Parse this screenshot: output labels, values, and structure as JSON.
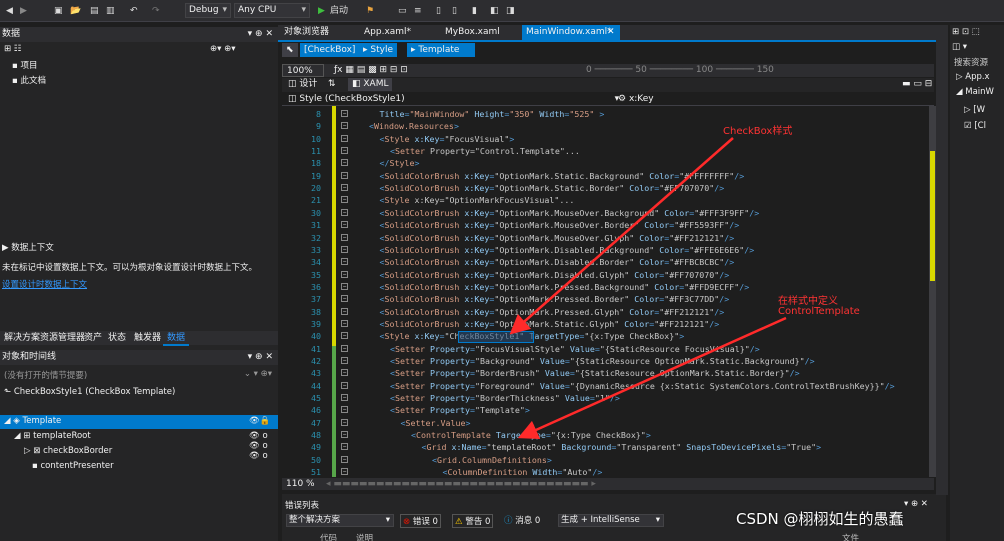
{
  "toolbar": {
    "config": "Debug",
    "platform": "Any CPU",
    "start": "启动"
  },
  "left": {
    "data_panel_title": "数据",
    "tree_items": [
      "项目",
      "此文档"
    ],
    "context_title": "数据上下文",
    "context_text": "未在标记中设置数据上下文。可以为根对象设置设计时数据上下文。",
    "context_link": "设置设计时数据上下文",
    "tabs": [
      "解决方案资源管理器",
      "资产",
      "状态",
      "触发器",
      "数据"
    ],
    "objects_title": "对象和时间线",
    "no_storyboard": "(没有打开的情节提要)",
    "style_title": "CheckBoxStyle1 (CheckBox Template)",
    "obj_tree": [
      "Template",
      "templateRoot",
      "checkBoxBorder",
      "contentPresenter"
    ]
  },
  "doc_tabs": [
    "对象浏览器",
    "App.xaml*",
    "MyBox.xaml",
    "MainWindow.xaml*"
  ],
  "breadcrumb": [
    "[CheckBox]",
    "Style",
    "Template"
  ],
  "design": {
    "zoom": "100%",
    "design_tab": "设计",
    "xaml_tab": "XAML"
  },
  "nav_left": "Style (CheckBoxStyle1)",
  "nav_right": "x:Key",
  "code_lines": [
    {
      "n": "8",
      "c": [
        [
          "t-att",
          "Title"
        ],
        [
          "t-tag",
          "="
        ],
        [
          "t-str",
          "\"MainWindow\""
        ],
        [
          "t-att",
          " Height"
        ],
        [
          "t-tag",
          "="
        ],
        [
          "t-str",
          "\"350\""
        ],
        [
          "t-att",
          " Width"
        ],
        [
          "t-tag",
          "="
        ],
        [
          "t-str",
          "\"525\""
        ],
        [
          "t-tag",
          " >"
        ]
      ],
      "i": 1
    },
    {
      "n": "9",
      "c": [
        [
          "t-tag",
          "<"
        ],
        [
          "t-str",
          "Window.Resources"
        ],
        [
          "t-tag",
          ">"
        ]
      ],
      "i": 0
    },
    {
      "n": "10",
      "c": [
        [
          "t-tag",
          "<"
        ],
        [
          "t-str",
          "Style"
        ],
        [
          "t-att",
          " x:Key"
        ],
        [
          "t-tag",
          "="
        ],
        [
          "t-val",
          "\"FocusVisual\""
        ],
        [
          "t-tag",
          ">"
        ]
      ],
      "i": 1
    },
    {
      "n": "11",
      "c": [
        [
          "t-tag",
          "<"
        ],
        [
          "t-str",
          "Setter"
        ],
        [
          "t-val",
          " Property=\"Control.Template\"..."
        ]
      ],
      "i": 2
    },
    {
      "n": "18",
      "c": [
        [
          "t-tag",
          "</"
        ],
        [
          "t-str",
          "Style"
        ],
        [
          "t-tag",
          ">"
        ]
      ],
      "i": 1
    },
    {
      "n": "19",
      "c": [
        [
          "t-tag",
          "<"
        ],
        [
          "t-str",
          "SolidColorBrush"
        ],
        [
          "t-att",
          " x:Key"
        ],
        [
          "t-tag",
          "="
        ],
        [
          "t-val",
          "\"OptionMark.Static.Background\""
        ],
        [
          "t-att",
          " Color"
        ],
        [
          "t-tag",
          "="
        ],
        [
          "t-val",
          "\"#FFFFFFFF\""
        ],
        [
          "t-tag",
          "/>"
        ]
      ],
      "i": 1
    },
    {
      "n": "20",
      "c": [
        [
          "t-tag",
          "<"
        ],
        [
          "t-str",
          "SolidColorBrush"
        ],
        [
          "t-att",
          " x:Key"
        ],
        [
          "t-tag",
          "="
        ],
        [
          "t-val",
          "\"OptionMark.Static.Border\""
        ],
        [
          "t-att",
          " Color"
        ],
        [
          "t-tag",
          "="
        ],
        [
          "t-val",
          "\"#FF707070\""
        ],
        [
          "t-tag",
          "/>"
        ]
      ],
      "i": 1
    },
    {
      "n": "21",
      "c": [
        [
          "t-tag",
          "<"
        ],
        [
          "t-str",
          "Style"
        ],
        [
          "t-val",
          " x:Key=\"OptionMarkFocusVisual\"..."
        ]
      ],
      "i": 1
    },
    {
      "n": "30",
      "c": [
        [
          "t-tag",
          "<"
        ],
        [
          "t-str",
          "SolidColorBrush"
        ],
        [
          "t-att",
          " x:Key"
        ],
        [
          "t-tag",
          "="
        ],
        [
          "t-val",
          "\"OptionMark.MouseOver.Background\""
        ],
        [
          "t-att",
          " Color"
        ],
        [
          "t-tag",
          "="
        ],
        [
          "t-val",
          "\"#FFF3F9FF\""
        ],
        [
          "t-tag",
          "/>"
        ]
      ],
      "i": 1
    },
    {
      "n": "31",
      "c": [
        [
          "t-tag",
          "<"
        ],
        [
          "t-str",
          "SolidColorBrush"
        ],
        [
          "t-att",
          " x:Key"
        ],
        [
          "t-tag",
          "="
        ],
        [
          "t-val",
          "\"OptionMark.MouseOver.Border\""
        ],
        [
          "t-att",
          " Color"
        ],
        [
          "t-tag",
          "="
        ],
        [
          "t-val",
          "\"#FF5593FF\""
        ],
        [
          "t-tag",
          "/>"
        ]
      ],
      "i": 1
    },
    {
      "n": "32",
      "c": [
        [
          "t-tag",
          "<"
        ],
        [
          "t-str",
          "SolidColorBrush"
        ],
        [
          "t-att",
          " x:Key"
        ],
        [
          "t-tag",
          "="
        ],
        [
          "t-val",
          "\"OptionMark.MouseOver.Glyph\""
        ],
        [
          "t-att",
          " Color"
        ],
        [
          "t-tag",
          "="
        ],
        [
          "t-val",
          "\"#FF212121\""
        ],
        [
          "t-tag",
          "/>"
        ]
      ],
      "i": 1
    },
    {
      "n": "33",
      "c": [
        [
          "t-tag",
          "<"
        ],
        [
          "t-str",
          "SolidColorBrush"
        ],
        [
          "t-att",
          " x:Key"
        ],
        [
          "t-tag",
          "="
        ],
        [
          "t-val",
          "\"OptionMark.Disabled.Background\""
        ],
        [
          "t-att",
          " Color"
        ],
        [
          "t-tag",
          "="
        ],
        [
          "t-val",
          "\"#FFE6E6E6\""
        ],
        [
          "t-tag",
          "/>"
        ]
      ],
      "i": 1
    },
    {
      "n": "34",
      "c": [
        [
          "t-tag",
          "<"
        ],
        [
          "t-str",
          "SolidColorBrush"
        ],
        [
          "t-att",
          " x:Key"
        ],
        [
          "t-tag",
          "="
        ],
        [
          "t-val",
          "\"OptionMark.Disabled.Border\""
        ],
        [
          "t-att",
          " Color"
        ],
        [
          "t-tag",
          "="
        ],
        [
          "t-val",
          "\"#FFBCBCBC\""
        ],
        [
          "t-tag",
          "/>"
        ]
      ],
      "i": 1
    },
    {
      "n": "35",
      "c": [
        [
          "t-tag",
          "<"
        ],
        [
          "t-str",
          "SolidColorBrush"
        ],
        [
          "t-att",
          " x:Key"
        ],
        [
          "t-tag",
          "="
        ],
        [
          "t-val",
          "\"OptionMark.Disabled.Glyph\""
        ],
        [
          "t-att",
          " Color"
        ],
        [
          "t-tag",
          "="
        ],
        [
          "t-val",
          "\"#FF707070\""
        ],
        [
          "t-tag",
          "/>"
        ]
      ],
      "i": 1
    },
    {
      "n": "36",
      "c": [
        [
          "t-tag",
          "<"
        ],
        [
          "t-str",
          "SolidColorBrush"
        ],
        [
          "t-att",
          " x:Key"
        ],
        [
          "t-tag",
          "="
        ],
        [
          "t-val",
          "\"OptionMark.Pressed.Background\""
        ],
        [
          "t-att",
          " Color"
        ],
        [
          "t-tag",
          "="
        ],
        [
          "t-val",
          "\"#FFD9ECFF\""
        ],
        [
          "t-tag",
          "/>"
        ]
      ],
      "i": 1
    },
    {
      "n": "37",
      "c": [
        [
          "t-tag",
          "<"
        ],
        [
          "t-str",
          "SolidColorBrush"
        ],
        [
          "t-att",
          " x:Key"
        ],
        [
          "t-tag",
          "="
        ],
        [
          "t-val",
          "\"OptionMark.Pressed.Border\""
        ],
        [
          "t-att",
          " Color"
        ],
        [
          "t-tag",
          "="
        ],
        [
          "t-val",
          "\"#FF3C77DD\""
        ],
        [
          "t-tag",
          "/>"
        ]
      ],
      "i": 1
    },
    {
      "n": "38",
      "c": [
        [
          "t-tag",
          "<"
        ],
        [
          "t-str",
          "SolidColorBrush"
        ],
        [
          "t-att",
          " x:Key"
        ],
        [
          "t-tag",
          "="
        ],
        [
          "t-val",
          "\"OptionMark.Pressed.Glyph\""
        ],
        [
          "t-att",
          " Color"
        ],
        [
          "t-tag",
          "="
        ],
        [
          "t-val",
          "\"#FF212121\""
        ],
        [
          "t-tag",
          "/>"
        ]
      ],
      "i": 1
    },
    {
      "n": "39",
      "c": [
        [
          "t-tag",
          "<"
        ],
        [
          "t-str",
          "SolidColorBrush"
        ],
        [
          "t-att",
          " x:Key"
        ],
        [
          "t-tag",
          "="
        ],
        [
          "t-val",
          "\"OptionMark.Static.Glyph\""
        ],
        [
          "t-att",
          " Color"
        ],
        [
          "t-tag",
          "="
        ],
        [
          "t-val",
          "\"#FF212121\""
        ],
        [
          "t-tag",
          "/>"
        ]
      ],
      "i": 1
    },
    {
      "n": "40",
      "c": [
        [
          "t-tag",
          "<"
        ],
        [
          "t-str",
          "Style"
        ],
        [
          "t-att",
          " x:Key"
        ],
        [
          "t-tag",
          "="
        ],
        [
          "t-val",
          "\"CheckBoxStyle1\""
        ],
        [
          "t-att",
          " TargetType"
        ],
        [
          "t-tag",
          "="
        ],
        [
          "t-val",
          "\"{x:Type CheckBox}\""
        ],
        [
          "t-tag",
          ">"
        ]
      ],
      "i": 1
    },
    {
      "n": "41",
      "c": [
        [
          "t-tag",
          "<"
        ],
        [
          "t-str",
          "Setter"
        ],
        [
          "t-att",
          " Property"
        ],
        [
          "t-tag",
          "="
        ],
        [
          "t-val",
          "\"FocusVisualStyle\""
        ],
        [
          "t-att",
          " Value"
        ],
        [
          "t-tag",
          "="
        ],
        [
          "t-val",
          "\"{StaticResource FocusVisual}\""
        ],
        [
          "t-tag",
          "/>"
        ]
      ],
      "i": 2
    },
    {
      "n": "42",
      "c": [
        [
          "t-tag",
          "<"
        ],
        [
          "t-str",
          "Setter"
        ],
        [
          "t-att",
          " Property"
        ],
        [
          "t-tag",
          "="
        ],
        [
          "t-val",
          "\"Background\""
        ],
        [
          "t-att",
          " Value"
        ],
        [
          "t-tag",
          "="
        ],
        [
          "t-val",
          "\"{StaticResource OptionMark.Static.Background}\""
        ],
        [
          "t-tag",
          "/>"
        ]
      ],
      "i": 2
    },
    {
      "n": "43",
      "c": [
        [
          "t-tag",
          "<"
        ],
        [
          "t-str",
          "Setter"
        ],
        [
          "t-att",
          " Property"
        ],
        [
          "t-tag",
          "="
        ],
        [
          "t-val",
          "\"BorderBrush\""
        ],
        [
          "t-att",
          " Value"
        ],
        [
          "t-tag",
          "="
        ],
        [
          "t-val",
          "\"{StaticResource OptionMark.Static.Border}\""
        ],
        [
          "t-tag",
          "/>"
        ]
      ],
      "i": 2
    },
    {
      "n": "44",
      "c": [
        [
          "t-tag",
          "<"
        ],
        [
          "t-str",
          "Setter"
        ],
        [
          "t-att",
          " Property"
        ],
        [
          "t-tag",
          "="
        ],
        [
          "t-val",
          "\"Foreground\""
        ],
        [
          "t-att",
          " Value"
        ],
        [
          "t-tag",
          "="
        ],
        [
          "t-val",
          "\"{DynamicResource {x:Static SystemColors.ControlTextBrushKey}}\""
        ],
        [
          "t-tag",
          "/>"
        ]
      ],
      "i": 2
    },
    {
      "n": "45",
      "c": [
        [
          "t-tag",
          "<"
        ],
        [
          "t-str",
          "Setter"
        ],
        [
          "t-att",
          " Property"
        ],
        [
          "t-tag",
          "="
        ],
        [
          "t-val",
          "\"BorderThickness\""
        ],
        [
          "t-att",
          " Value"
        ],
        [
          "t-tag",
          "="
        ],
        [
          "t-val",
          "\"1\""
        ],
        [
          "t-tag",
          "/>"
        ]
      ],
      "i": 2
    },
    {
      "n": "46",
      "c": [
        [
          "t-tag",
          "<"
        ],
        [
          "t-str",
          "Setter"
        ],
        [
          "t-att",
          " Property"
        ],
        [
          "t-tag",
          "="
        ],
        [
          "t-val",
          "\"Template\""
        ],
        [
          "t-tag",
          ">"
        ]
      ],
      "i": 2
    },
    {
      "n": "47",
      "c": [
        [
          "t-tag",
          "<"
        ],
        [
          "t-str",
          "Setter.Value"
        ],
        [
          "t-tag",
          ">"
        ]
      ],
      "i": 3
    },
    {
      "n": "48",
      "c": [
        [
          "t-tag",
          "<"
        ],
        [
          "t-str",
          "ControlTemplate"
        ],
        [
          "t-att",
          " TargetType"
        ],
        [
          "t-tag",
          "="
        ],
        [
          "t-val",
          "\"{x:Type CheckBox}\""
        ],
        [
          "t-tag",
          ">"
        ]
      ],
      "i": 4
    },
    {
      "n": "49",
      "c": [
        [
          "t-tag",
          "<"
        ],
        [
          "t-str",
          "Grid"
        ],
        [
          "t-att",
          " x:Name"
        ],
        [
          "t-tag",
          "="
        ],
        [
          "t-val",
          "\"templateRoot\""
        ],
        [
          "t-att",
          " Background"
        ],
        [
          "t-tag",
          "="
        ],
        [
          "t-val",
          "\"Transparent\""
        ],
        [
          "t-att",
          " SnapsToDevicePixels"
        ],
        [
          "t-tag",
          "="
        ],
        [
          "t-val",
          "\"True\""
        ],
        [
          "t-tag",
          ">"
        ]
      ],
      "i": 5
    },
    {
      "n": "50",
      "c": [
        [
          "t-tag",
          "<"
        ],
        [
          "t-str",
          "Grid.ColumnDefinitions"
        ],
        [
          "t-tag",
          ">"
        ]
      ],
      "i": 6
    },
    {
      "n": "51",
      "c": [
        [
          "t-tag",
          "<"
        ],
        [
          "t-str",
          "ColumnDefinition"
        ],
        [
          "t-att",
          " Width"
        ],
        [
          "t-tag",
          "="
        ],
        [
          "t-val",
          "\"Auto\""
        ],
        [
          "t-tag",
          "/>"
        ]
      ],
      "i": 7
    }
  ],
  "annotations": {
    "a1": "CheckBox样式",
    "a2": "在样式中定义",
    "a3": "ControlTemplate"
  },
  "editor_zoom": "110 %",
  "errors": {
    "title": "错误列表",
    "scope": "整个解决方案",
    "err": "错误 0",
    "warn": "警告 0",
    "msg": "消息 0",
    "build": "生成 + IntelliSense",
    "col1": "代码",
    "col2": "说明",
    "col3": "文件"
  },
  "right": {
    "search": "搜索资源",
    "items": [
      "App.x",
      "MainW",
      "[W",
      "[Cl"
    ]
  },
  "watermark": "CSDN @栩栩如生的愚蠢"
}
